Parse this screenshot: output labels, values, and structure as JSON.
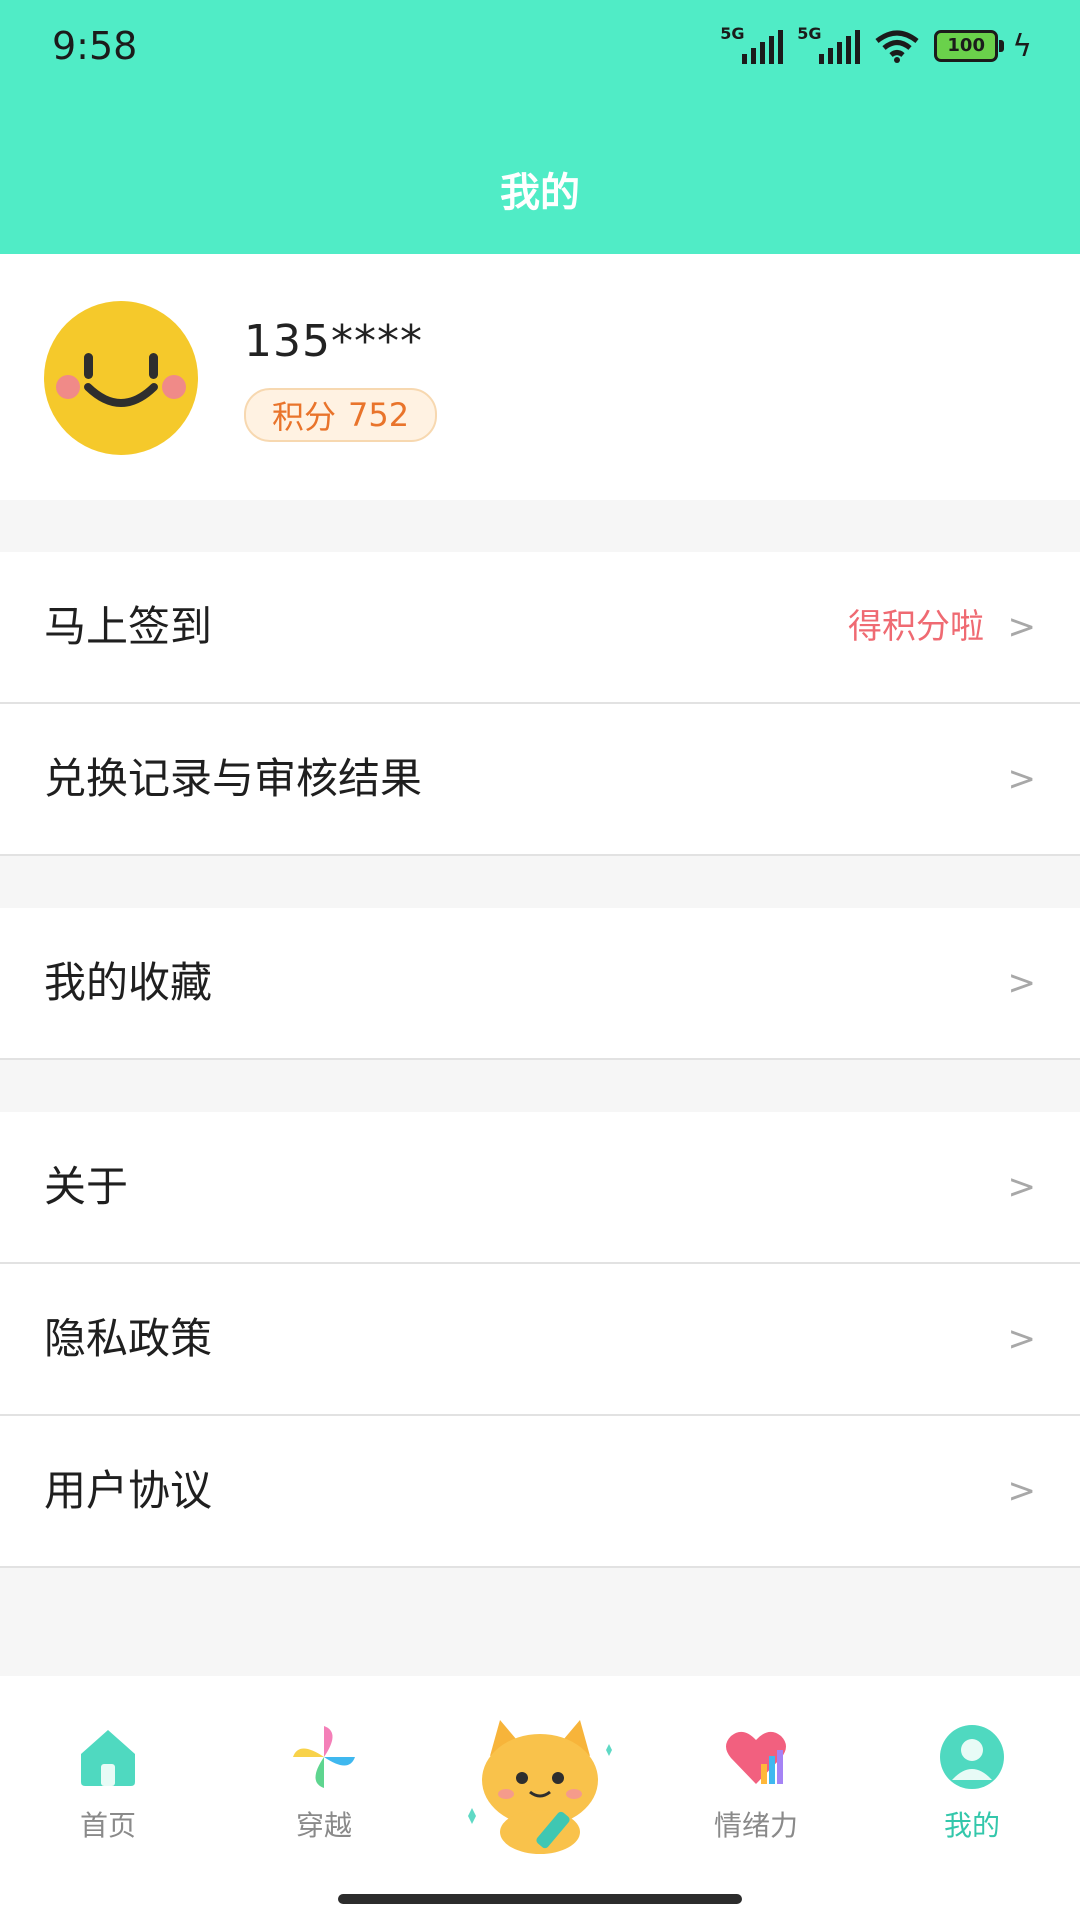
{
  "status_bar": {
    "time": "9:58",
    "net1": "5G",
    "net2": "5G",
    "battery": "100"
  },
  "header": {
    "title": "我的"
  },
  "profile": {
    "username": "135****",
    "points_label": "积分",
    "points_value": "752"
  },
  "menu": {
    "checkin_label": "马上签到",
    "checkin_hint": "得积分啦",
    "exchange_label": "兑换记录与审核结果",
    "favorites_label": "我的收藏",
    "about_label": "关于",
    "privacy_label": "隐私政策",
    "agreement_label": "用户协议",
    "chevron": ">"
  },
  "tabs": [
    {
      "label": "首页",
      "icon": "home-icon"
    },
    {
      "label": "穿越",
      "icon": "pinwheel-icon"
    },
    {
      "label": "",
      "icon": "cat-mascot-icon"
    },
    {
      "label": "情绪力",
      "icon": "heart-chart-icon"
    },
    {
      "label": "我的",
      "icon": "user-icon",
      "active": true
    }
  ],
  "colors": {
    "accent": "#50ecc6",
    "active_tab": "#33c7ab",
    "hint": "#ef6a72",
    "points": "#e9742b"
  }
}
